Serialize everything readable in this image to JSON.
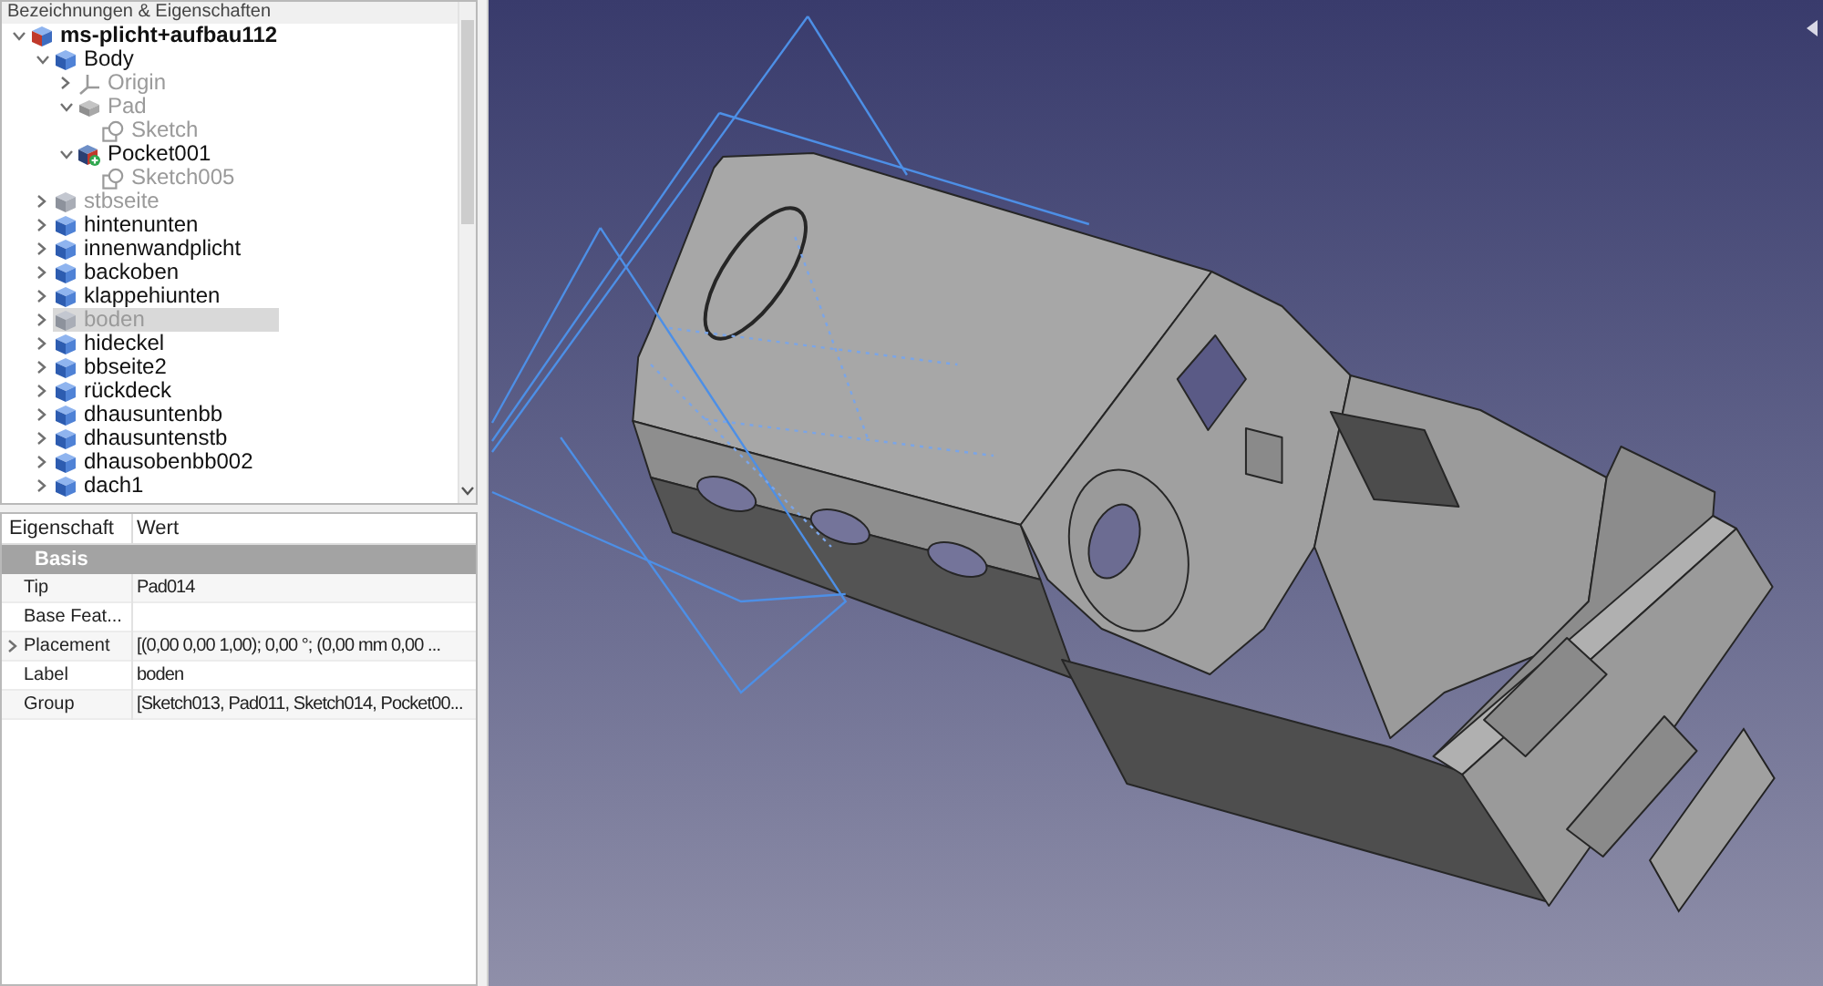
{
  "panel_title": "Bezeichnungen & Eigenschaften",
  "tree": [
    {
      "label": "ms-plicht+aufbau112",
      "kind": "document",
      "expanded": true,
      "hidden": false,
      "selected": false,
      "children": [
        {
          "label": "Body",
          "kind": "body",
          "expanded": true,
          "hidden": false,
          "selected": false,
          "children": [
            {
              "label": "Origin",
              "kind": "origin",
              "expanded": false,
              "hidden": true,
              "selected": false
            },
            {
              "label": "Pad",
              "kind": "pad",
              "expanded": true,
              "hidden": true,
              "selected": false,
              "children": [
                {
                  "label": "Sketch",
                  "kind": "sketch",
                  "hidden": true,
                  "selected": false
                }
              ]
            },
            {
              "label": "Pocket001",
              "kind": "pocket",
              "expanded": true,
              "hidden": false,
              "selected": false,
              "children": [
                {
                  "label": "Sketch005",
                  "kind": "sketch",
                  "hidden": true,
                  "selected": false
                }
              ]
            }
          ]
        },
        {
          "label": "stbseite",
          "kind": "body",
          "expanded": false,
          "hidden": true,
          "selected": false
        },
        {
          "label": "hintenunten",
          "kind": "body",
          "expanded": false,
          "hidden": false,
          "selected": false
        },
        {
          "label": "innenwandplicht",
          "kind": "body",
          "expanded": false,
          "hidden": false,
          "selected": false
        },
        {
          "label": "backoben",
          "kind": "body",
          "expanded": false,
          "hidden": false,
          "selected": false
        },
        {
          "label": "klappehiunten",
          "kind": "body",
          "expanded": false,
          "hidden": false,
          "selected": false
        },
        {
          "label": "boden",
          "kind": "body",
          "expanded": false,
          "hidden": true,
          "selected": true
        },
        {
          "label": "hideckel",
          "kind": "body",
          "expanded": false,
          "hidden": false,
          "selected": false
        },
        {
          "label": "bbseite2",
          "kind": "body",
          "expanded": false,
          "hidden": false,
          "selected": false
        },
        {
          "label": "rückdeck",
          "kind": "body",
          "expanded": false,
          "hidden": false,
          "selected": false
        },
        {
          "label": "dhausuntenbb",
          "kind": "body",
          "expanded": false,
          "hidden": false,
          "selected": false
        },
        {
          "label": "dhausuntenstb",
          "kind": "body",
          "expanded": false,
          "hidden": false,
          "selected": false
        },
        {
          "label": "dhausobenbb002",
          "kind": "body",
          "expanded": false,
          "hidden": false,
          "selected": false
        },
        {
          "label": "dach1",
          "kind": "body",
          "expanded": false,
          "hidden": false,
          "selected": false
        }
      ]
    }
  ],
  "properties": {
    "columns": [
      "Eigenschaft",
      "Wert"
    ],
    "groups": [
      {
        "name": "Basis",
        "rows": [
          {
            "name": "Tip",
            "value": "Pad014"
          },
          {
            "name": "Base Feat..."
          },
          {
            "name": "Placement",
            "value": "[(0,00 0,00 1,00); 0,00 °; (0,00 mm  0,00 ...",
            "expanded": false
          },
          {
            "name": "Label",
            "value": "boden"
          },
          {
            "name": "Group",
            "value": "[Sketch013, Pad011, Sketch014, Pocket00..."
          }
        ]
      }
    ]
  }
}
